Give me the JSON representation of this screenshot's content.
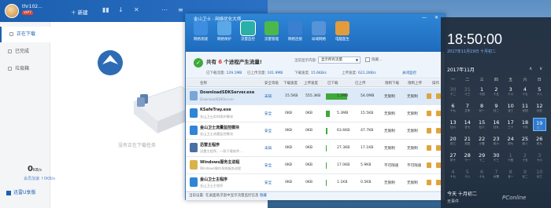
{
  "thunder": {
    "user": "thr102...",
    "vip": "VIP7",
    "new_btn": "＋ 新建",
    "sidebar": [
      {
        "label": "正在下载"
      },
      {
        "label": "已完成"
      },
      {
        "label": "垃圾箱"
      }
    ],
    "speed": "0",
    "speed_unit": "KB/s",
    "speed_sub": "会员加速 ↑0KB/s",
    "vip_btn": "迅雷U享版",
    "empty_text": "没有正在下载任务"
  },
  "security": {
    "title": "金山卫士 · 网络优化大师",
    "toolbar": [
      {
        "label": "网络测速",
        "color": "#3d8ee0"
      },
      {
        "label": "网络保护",
        "color": "#5aa8e8"
      },
      {
        "label": "流量监控",
        "color": "#2bb0a8"
      },
      {
        "label": "流量管理",
        "color": "#4cb84c"
      },
      {
        "label": "网络连接",
        "color": "#3a7fd0"
      },
      {
        "label": "局域网络",
        "color": "#5793d8"
      },
      {
        "label": "电脑医生",
        "color": "#e29b3d"
      }
    ],
    "summary_prefix": "共有",
    "summary_count": "6",
    "summary_suffix": "个进程产生流量!",
    "dl_total_label": "已下载流量:",
    "dl_total": "129.1MB",
    "ul_total_label": "已上传流量:",
    "ul_total": "101.9MB",
    "dl_speed_label": "下载速度:",
    "dl_speed": "15.6KB/s",
    "ul_speed_label": "上传速度:",
    "ul_speed": "621.2KB/s",
    "filter_label": "当前显示内容:",
    "filter_value": "显示所有流量",
    "hide_label": "隐藏...",
    "close_monitor": "关闭监控",
    "columns": [
      "名称",
      "安全等级",
      "下载速度",
      "上传速度",
      "已下载",
      "已上传",
      "限制下载",
      "限制上传",
      "操作"
    ],
    "rows": [
      {
        "name": "DownloadSDKServer.exe",
        "desc": "DownloadSDKServer",
        "level": "未知",
        "dl": "15.5KB",
        "ul": "555.3KB",
        "dl_total": "1.2MB",
        "ul_total": "54.0MB",
        "lim_dl": "无限制",
        "lim_ul": "无限制",
        "icon": "#7aa6d6",
        "bar": 0.9,
        "selected": true
      },
      {
        "name": "KSafeTray.exe",
        "desc": "金山卫士实时保护模块",
        "level": "安全",
        "dl": "0KB",
        "ul": "0KB",
        "dl_total": "5.3MB",
        "ul_total": "15.5KB",
        "lim_dl": "无限制",
        "lim_ul": "无限制",
        "icon": "#2f86d6",
        "bar": 0.15,
        "selected": false
      },
      {
        "name": "金山卫士流量监控模块",
        "desc": "金山卫士流量监控模块",
        "level": "安全",
        "dl": "0KB",
        "ul": "0KB",
        "dl_total": "63.6KB",
        "ul_total": "47.7KB",
        "lim_dl": "无限制",
        "lim_ul": "无限制",
        "icon": "#2f86d6",
        "bar": 0.05,
        "selected": false
      },
      {
        "name": "迅雷主程序",
        "desc": "迅雷主程序，一款下载软件...",
        "level": "未知",
        "dl": "0KB",
        "ul": "0KB",
        "dl_total": "27.3KB",
        "ul_total": "17.1KB",
        "lim_dl": "无限制",
        "lim_ul": "无限制",
        "icon": "#4a6fa5",
        "bar": 0.04,
        "selected": false
      },
      {
        "name": "Windows服务主进程",
        "desc": "Windows操作系统服务进程",
        "level": "安全",
        "dl": "0KB",
        "ul": "0KB",
        "dl_total": "17.0KB",
        "ul_total": "5.9KB",
        "lim_dl": "不可限速",
        "lim_ul": "不可限速",
        "icon": "#d9b34a",
        "bar": 0.03,
        "selected": false
      },
      {
        "name": "金山卫士主程序",
        "desc": "金山卫士主程序",
        "level": "安全",
        "dl": "0KB",
        "ul": "0KB",
        "dl_total": "1.1KB",
        "ul_total": "0.5KB",
        "lim_dl": "无限制",
        "lim_ul": "无限制",
        "icon": "#2f86d6",
        "bar": 0.01,
        "selected": false
      }
    ],
    "footer_prefix": "当前设置:",
    "footer_text": "在桌面悬浮窗中显示流量监控信息",
    "footer_link": "隐藏"
  },
  "calendar": {
    "time": "18:50:00",
    "date": "2017年11月19日  十月初二",
    "month": "2017年11月",
    "weekdays": [
      "一",
      "二",
      "三",
      "四",
      "五",
      "六",
      "日"
    ],
    "days": [
      {
        "d": "30",
        "l": "十二",
        "dim": true
      },
      {
        "d": "31",
        "l": "十三",
        "dim": true
      },
      {
        "d": "1",
        "l": "十四"
      },
      {
        "d": "2",
        "l": "十五"
      },
      {
        "d": "3",
        "l": "十六"
      },
      {
        "d": "4",
        "l": "十七"
      },
      {
        "d": "5",
        "l": "十八"
      },
      {
        "d": "6",
        "l": "十九"
      },
      {
        "d": "7",
        "l": "立冬"
      },
      {
        "d": "8",
        "l": "廿一"
      },
      {
        "d": "9",
        "l": "廿二"
      },
      {
        "d": "10",
        "l": "廿三"
      },
      {
        "d": "11",
        "l": "廿四"
      },
      {
        "d": "12",
        "l": "廿五"
      },
      {
        "d": "13",
        "l": "廿六"
      },
      {
        "d": "14",
        "l": "廿七"
      },
      {
        "d": "15",
        "l": "廿八"
      },
      {
        "d": "16",
        "l": "廿九"
      },
      {
        "d": "17",
        "l": "三十"
      },
      {
        "d": "18",
        "l": "十月"
      },
      {
        "d": "19",
        "l": "初二",
        "today": true
      },
      {
        "d": "20",
        "l": "初三"
      },
      {
        "d": "21",
        "l": "初四"
      },
      {
        "d": "22",
        "l": "小雪"
      },
      {
        "d": "23",
        "l": "初六"
      },
      {
        "d": "24",
        "l": "初七"
      },
      {
        "d": "25",
        "l": "初八"
      },
      {
        "d": "26",
        "l": "初九"
      },
      {
        "d": "27",
        "l": "初十"
      },
      {
        "d": "28",
        "l": "十一"
      },
      {
        "d": "29",
        "l": "十二"
      },
      {
        "d": "30",
        "l": "十三"
      },
      {
        "d": "1",
        "l": "十四",
        "dim": true
      },
      {
        "d": "2",
        "l": "十五",
        "dim": true
      },
      {
        "d": "3",
        "l": "十六",
        "dim": true
      },
      {
        "d": "4",
        "l": "十七",
        "dim": true
      },
      {
        "d": "5",
        "l": "十八",
        "dim": true
      },
      {
        "d": "6",
        "l": "十九",
        "dim": true
      },
      {
        "d": "7",
        "l": "大雪",
        "dim": true
      },
      {
        "d": "8",
        "l": "廿一",
        "dim": true
      },
      {
        "d": "9",
        "l": "廿二",
        "dim": true
      },
      {
        "d": "10",
        "l": "廿三",
        "dim": true
      }
    ],
    "footer": "今天 十月初二",
    "no_events": "无事件",
    "watermark": "PConline"
  }
}
